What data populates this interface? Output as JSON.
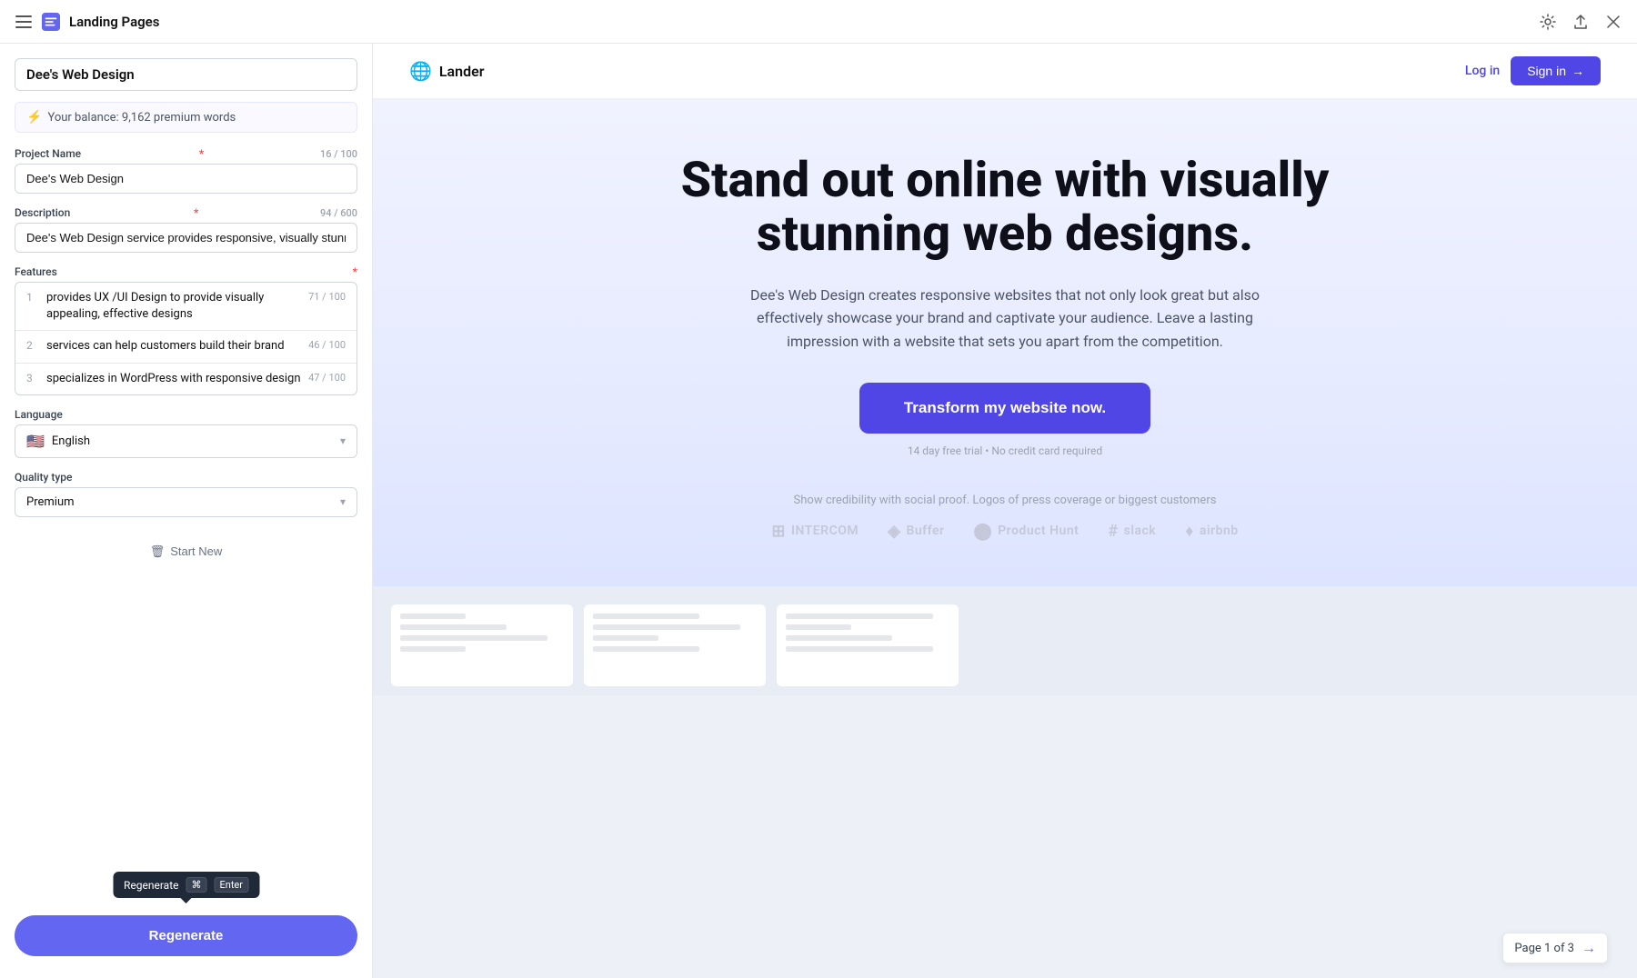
{
  "topbar": {
    "title": "Landing Pages",
    "icon_alt": "landing-pages-icon"
  },
  "sidebar": {
    "project_name_header": "Dee's Web Design",
    "balance": {
      "label": "Your balance: 9,162 premium words"
    },
    "project_name": {
      "label": "Project Name",
      "required": true,
      "counter": "16 / 100",
      "value": "Dee's Web Design"
    },
    "description": {
      "label": "Description",
      "required": true,
      "counter": "94 / 600",
      "value": "Dee's Web Design service provides responsive, visually stunning de"
    },
    "features": {
      "label": "Features",
      "required": true,
      "items": [
        {
          "num": "1",
          "text": "provides UX /UI Design to provide visually appealing, effective designs",
          "counter": "71 / 100"
        },
        {
          "num": "2",
          "text": "services can help customers build their brand",
          "counter": "46 / 100"
        },
        {
          "num": "3",
          "text": "specializes in WordPress with responsive design",
          "counter": "47 / 100"
        }
      ]
    },
    "language": {
      "label": "Language",
      "flag": "🇺🇸",
      "value": "English"
    },
    "quality_type": {
      "label": "Quality type",
      "value": "Premium"
    },
    "start_new_label": "Start New",
    "regenerate_label": "Regenerate",
    "tooltip": {
      "label": "Regenerate",
      "kbd1": "⌘",
      "kbd2": "Enter"
    }
  },
  "preview": {
    "brand": "Lander",
    "nav": {
      "login": "Log in",
      "signin": "Sign in"
    },
    "hero": {
      "title": "Stand out online with visually stunning web designs.",
      "subtitle": "Dee's Web Design creates responsive websites that not only look great but also effectively showcase your brand and captivate your audience. Leave a lasting impression with a website that sets you apart from the competition.",
      "cta": "Transform my website now.",
      "cta_sub": "14 day free trial • No credit card required",
      "social_proof": "Show credibility with social proof. Logos of press coverage or biggest customers",
      "logos": [
        {
          "name": "INTERCOM"
        },
        {
          "name": "Buffer"
        },
        {
          "name": "Product Hunt"
        },
        {
          "name": "slack"
        },
        {
          "name": "airbnb"
        }
      ]
    },
    "page_nav": {
      "label": "Page 1 of 3"
    }
  },
  "colors": {
    "accent": "#6366f1",
    "brand_blue": "#4f46e5",
    "danger": "#ef4444"
  }
}
